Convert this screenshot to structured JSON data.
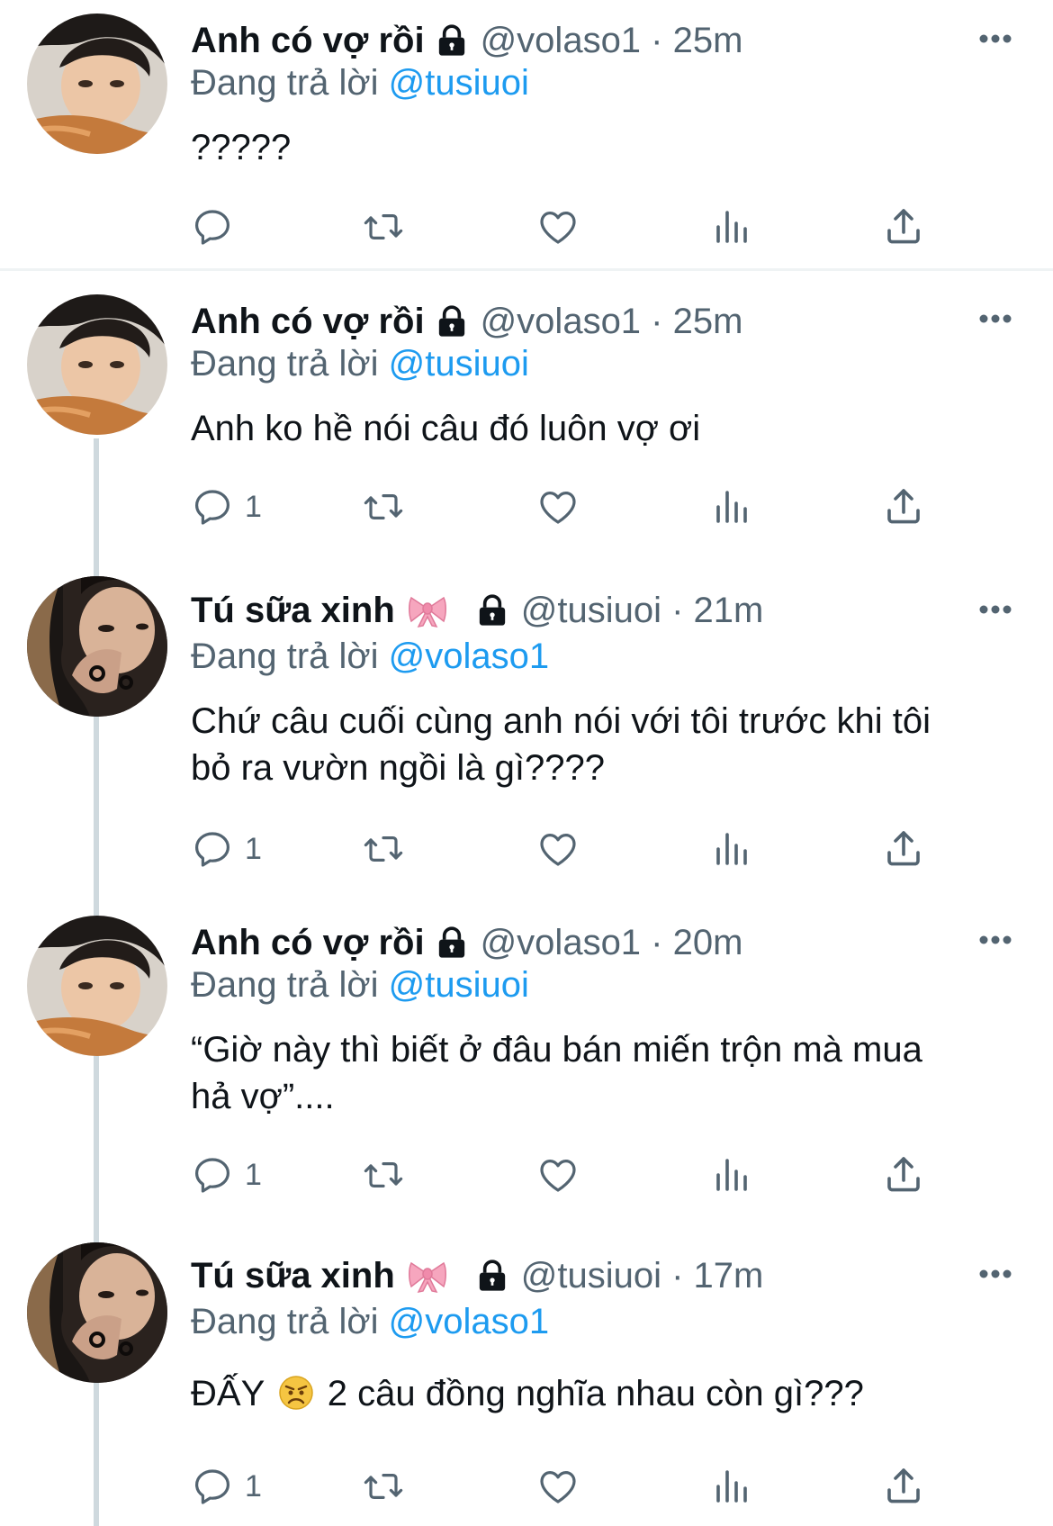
{
  "tweets": [
    {
      "name": "Anh có vợ rồi",
      "handle": "@volaso1 · 25m",
      "reply_prefix": "Đang trả lời",
      "reply_to": "@tusiuoi",
      "lines": [
        "?????"
      ],
      "reply_count": ""
    },
    {
      "name": "Anh có vợ rồi",
      "handle": "@volaso1 · 25m",
      "reply_prefix": "Đang trả lời",
      "reply_to": "@tusiuoi",
      "lines": [
        "Anh ko hề nói câu đó luôn vợ ơi"
      ],
      "reply_count": "1"
    },
    {
      "name": "Tú sữa xinh",
      "handle": "@tusiuoi · 21m",
      "reply_prefix": "Đang trả lời",
      "reply_to": "@volaso1",
      "lines": [
        "Chứ câu cuối cùng anh nói với tôi trước khi tôi",
        "bỏ ra vườn ngồi là gì????"
      ],
      "reply_count": "1"
    },
    {
      "name": "Anh có vợ rồi",
      "handle": "@volaso1 · 20m",
      "reply_prefix": "Đang trả lời",
      "reply_to": "@tusiuoi",
      "lines": [
        "“Giờ này thì biết ở đâu bán miến trộn mà mua",
        "hả vợ”...."
      ],
      "reply_count": "1"
    },
    {
      "name": "Tú sữa xinh",
      "handle": "@tusiuoi · 17m",
      "reply_prefix": "Đang trả lời",
      "reply_to": "@volaso1",
      "text_before_emoji": "ĐẤY",
      "text_after_emoji": "2 câu đồng nghĩa nhau còn gì???",
      "reply_count": "1"
    }
  ],
  "icons": {
    "reply": "reply-bubble-icon",
    "retweet": "retweet-icon",
    "like": "heart-icon",
    "views": "analytics-icon",
    "share": "share-icon",
    "lock": "lock-icon",
    "more": "more-dots-icon",
    "bow": "ribbon-bow-emoji",
    "emoji": "angry-face-emoji"
  },
  "colors": {
    "mention": "#1d9bf0",
    "secondary": "#536471",
    "text": "#0f1419",
    "divider": "#eff3f4",
    "thread_line": "#cfd9de"
  }
}
